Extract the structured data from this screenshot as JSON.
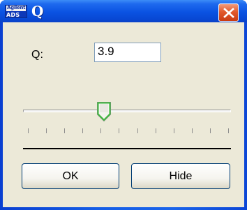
{
  "window": {
    "title": "Q",
    "app_icon": {
      "name": "agilent-ads-icon",
      "top_text": "Agilent",
      "bottom_text": "ADS"
    },
    "close_icon": "close-icon"
  },
  "form": {
    "label": "Q:",
    "value": "3.9"
  },
  "slider": {
    "tick_count": 12
  },
  "buttons": {
    "ok": "OK",
    "hide": "Hide"
  },
  "colors": {
    "titlebar": "#0a52e2",
    "dialog_bg": "#ece9d8",
    "close": "#e25a2c"
  }
}
